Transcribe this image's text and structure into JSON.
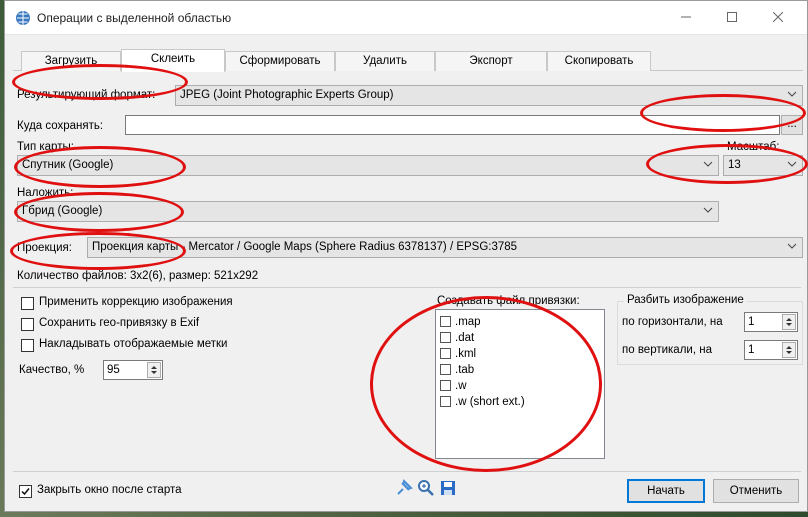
{
  "window": {
    "title": "Операции с выделенной областью"
  },
  "tabs": [
    {
      "label": "Загрузить"
    },
    {
      "label": "Склеить"
    },
    {
      "label": "Сформировать"
    },
    {
      "label": "Удалить"
    },
    {
      "label": "Экспорт"
    },
    {
      "label": "Скопировать"
    }
  ],
  "format": {
    "label": "Результирующий формат:",
    "value": "JPEG (Joint Photographic Experts Group)"
  },
  "save_path": {
    "label": "Куда сохранять:",
    "value": "",
    "browse_label": "..."
  },
  "map_type": {
    "label": "Тип карты:",
    "value": "Спутник (Google)"
  },
  "scale": {
    "label": "Масштаб:",
    "value": "13"
  },
  "overlay": {
    "label": "Наложить:",
    "value": "Гбрид (Google)"
  },
  "projection": {
    "label": "Проекция:",
    "value": "Проекция карты - Mercator / Google Maps (Sphere Radius 6378137) / EPSG:3785"
  },
  "file_count": "Количество файлов: 3x2(6), размер: 521x292",
  "options": [
    {
      "label": "Применить коррекцию изображения",
      "checked": false
    },
    {
      "label": "Сохранить гео-привязку в Exif",
      "checked": false
    },
    {
      "label": "Накладывать отображаемые метки",
      "checked": false
    }
  ],
  "quality": {
    "label": "Качество, %",
    "value": "95"
  },
  "georef": {
    "label": "Создавать файл привязки:",
    "items": [
      ".map",
      ".dat",
      ".kml",
      ".tab",
      ".w",
      ".w (short ext.)"
    ]
  },
  "split": {
    "title": "Разбить изображение",
    "horizontal_label": "по горизонтали, на",
    "horizontal_value": "1",
    "vertical_label": "по вертикали, на",
    "vertical_value": "1"
  },
  "close_after_start": {
    "label": "Закрыть окно после старта",
    "checked": true
  },
  "footer": {
    "start_label": "Начать",
    "cancel_label": "Отменить"
  },
  "colors": {
    "annotation": "#e01010",
    "accent": "#0078d7"
  }
}
